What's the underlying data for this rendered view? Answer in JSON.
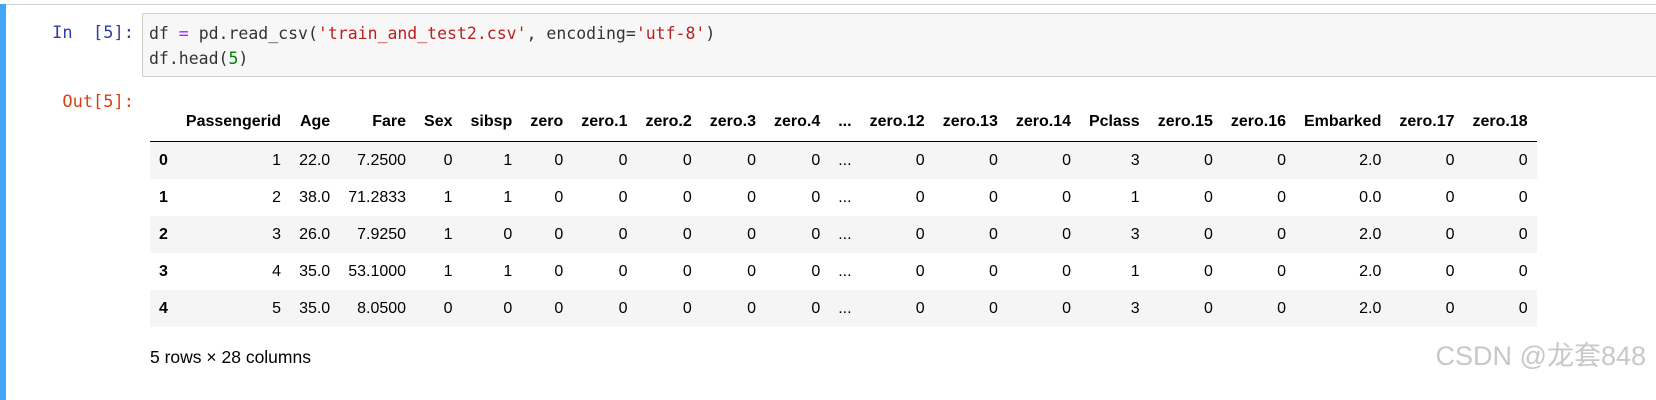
{
  "input_cell": {
    "prompt_label": "In",
    "prompt_count": "[5]:",
    "code_lines": [
      [
        {
          "t": "df",
          "c": "p"
        },
        {
          "t": " = ",
          "c": "op"
        },
        {
          "t": "pd.read_csv(",
          "c": "p"
        },
        {
          "t": "'train_and_test2.csv'",
          "c": "str"
        },
        {
          "t": ", encoding=",
          "c": "p"
        },
        {
          "t": "'utf-8'",
          "c": "str"
        },
        {
          "t": ")",
          "c": "p"
        }
      ],
      [
        {
          "t": "df.head(",
          "c": "p"
        },
        {
          "t": "5",
          "c": "num"
        },
        {
          "t": ")",
          "c": "p"
        }
      ]
    ]
  },
  "output_cell": {
    "prompt": "Out[5]:",
    "dataframe": {
      "columns": [
        "",
        "Passengerid",
        "Age",
        "Fare",
        "Sex",
        "sibsp",
        "zero",
        "zero.1",
        "zero.2",
        "zero.3",
        "zero.4",
        "...",
        "zero.12",
        "zero.13",
        "zero.14",
        "Pclass",
        "zero.15",
        "zero.16",
        "Embarked",
        "zero.17",
        "zero.18"
      ],
      "rows": [
        [
          "0",
          "1",
          "22.0",
          "7.2500",
          "0",
          "1",
          "0",
          "0",
          "0",
          "0",
          "0",
          "...",
          "0",
          "0",
          "0",
          "3",
          "0",
          "0",
          "2.0",
          "0",
          "0"
        ],
        [
          "1",
          "2",
          "38.0",
          "71.2833",
          "1",
          "1",
          "0",
          "0",
          "0",
          "0",
          "0",
          "...",
          "0",
          "0",
          "0",
          "1",
          "0",
          "0",
          "0.0",
          "0",
          "0"
        ],
        [
          "2",
          "3",
          "26.0",
          "7.9250",
          "1",
          "0",
          "0",
          "0",
          "0",
          "0",
          "0",
          "...",
          "0",
          "0",
          "0",
          "3",
          "0",
          "0",
          "2.0",
          "0",
          "0"
        ],
        [
          "3",
          "4",
          "35.0",
          "53.1000",
          "1",
          "1",
          "0",
          "0",
          "0",
          "0",
          "0",
          "...",
          "0",
          "0",
          "0",
          "1",
          "0",
          "0",
          "2.0",
          "0",
          "0"
        ],
        [
          "4",
          "5",
          "35.0",
          "8.0500",
          "0",
          "0",
          "0",
          "0",
          "0",
          "0",
          "0",
          "...",
          "0",
          "0",
          "0",
          "3",
          "0",
          "0",
          "2.0",
          "0",
          "0"
        ]
      ]
    },
    "shape_note": "5 rows × 28 columns"
  },
  "watermark": "CSDN @龙套848",
  "colors": {
    "cell_selected_bar": "#42a5f5",
    "in_prompt": "#303f9f",
    "out_prompt": "#d84315",
    "string_token": "#ba2121",
    "operator_token": "#aa22ff",
    "number_token": "#008000"
  }
}
